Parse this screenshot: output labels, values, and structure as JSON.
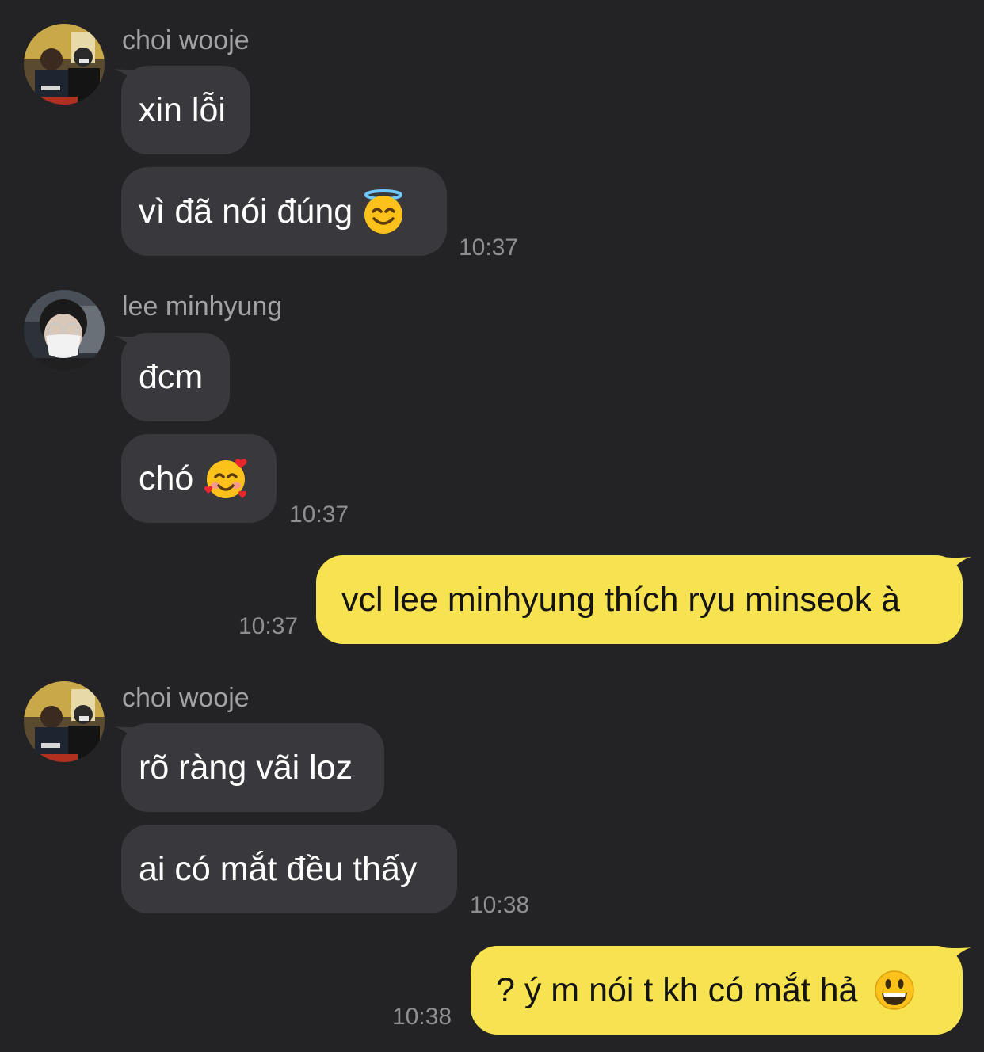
{
  "messages": [
    {
      "sender": "choi wooje",
      "avatar_icon": "profile-photo-choi-wooje",
      "bubbles": [
        "xin lỗi",
        "vì đã nói đúng"
      ],
      "emoji": "smiling-face-with-halo-icon",
      "time": "10:37"
    },
    {
      "sender": "lee minhyung",
      "avatar_icon": "profile-photo-lee-minhyung",
      "bubbles": [
        "đcm",
        "chó"
      ],
      "emoji": "smiling-face-with-hearts-icon",
      "time": "10:37"
    },
    {
      "sender": "me",
      "text": "vcl lee minhyung thích ryu minseok à",
      "time": "10:37"
    },
    {
      "sender": "choi wooje",
      "avatar_icon": "profile-photo-choi-wooje",
      "bubbles": [
        "rõ ràng vãi loz",
        "ai có mắt đều thấy"
      ],
      "time": "10:38"
    },
    {
      "sender": "me",
      "text": "? ý m nói t kh có mắt hả",
      "emoji": "grinning-face-icon",
      "time": "10:38"
    }
  ],
  "colors": {
    "background": "#232325",
    "incoming_bubble": "#39393d",
    "outgoing_bubble": "#f7e250",
    "sender_name": "#a2a2a6",
    "timestamp": "#8e8e93"
  }
}
